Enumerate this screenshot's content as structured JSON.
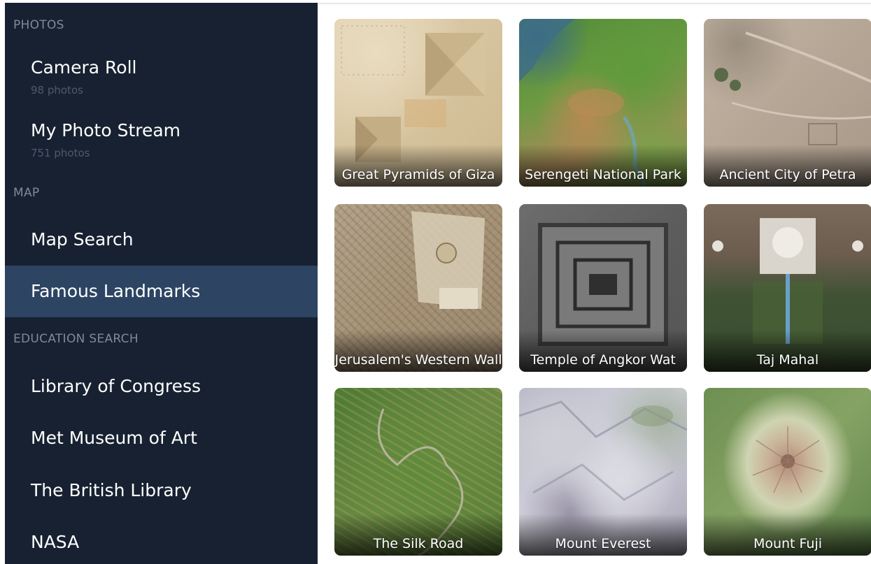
{
  "sidebar": {
    "sections": {
      "photos": "PHOTOS",
      "map": "MAP",
      "education": "EDUCATION SEARCH"
    },
    "items": {
      "camera_roll": {
        "title": "Camera Roll",
        "subtitle": "98 photos"
      },
      "photo_stream": {
        "title": "My Photo Stream",
        "subtitle": "751 photos"
      },
      "map_search": {
        "title": "Map Search"
      },
      "famous_landmarks": {
        "title": "Famous Landmarks",
        "selected": true
      },
      "library_of_congress": {
        "title": "Library of Congress"
      },
      "met_museum": {
        "title": "Met Museum of Art"
      },
      "british_library": {
        "title": "The British Library"
      },
      "nasa": {
        "title": "NASA"
      }
    }
  },
  "grid": {
    "tiles": [
      {
        "label": "Great Pyramids of Giza"
      },
      {
        "label": "Serengeti National Park"
      },
      {
        "label": "Ancient City of Petra"
      },
      {
        "label": "Jerusalem's Western Wall"
      },
      {
        "label": "Temple of Angkor Wat"
      },
      {
        "label": "Taj Mahal"
      },
      {
        "label": "The Silk Road"
      },
      {
        "label": "Mount Everest"
      },
      {
        "label": "Mount Fuji"
      }
    ]
  },
  "colors": {
    "sidebar_bg": "#172131",
    "selected_bg": "#2d4463",
    "section_header": "#7f8997",
    "subtitle": "#4e5a6b"
  }
}
